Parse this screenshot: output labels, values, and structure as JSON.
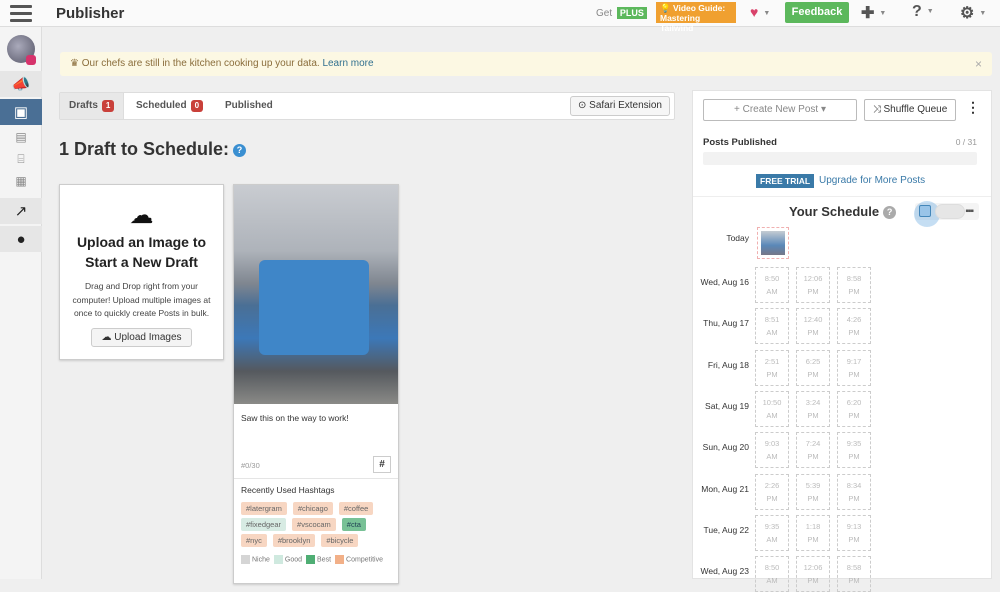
{
  "header": {
    "title": "Publisher",
    "get": "Get",
    "plus": "PLUS",
    "video_guide": "💡 Video Guide: Mastering Tailwind",
    "feedback": "Feedback"
  },
  "alert": {
    "text": "Our chefs are still in the kitchen cooking up your data.",
    "link": "Learn more",
    "close": "×"
  },
  "tabs": [
    {
      "label": "Drafts",
      "count": "1"
    },
    {
      "label": "Scheduled",
      "count": "0"
    },
    {
      "label": "Published"
    }
  ],
  "safari": "Safari Extension",
  "heading": "1 Draft to Schedule:",
  "upload": {
    "title": "Upload an Image to Start a New Draft",
    "desc": "Drag and Drop right from your computer! Upload multiple images at once to quickly create Posts in bulk.",
    "button": "Upload Images"
  },
  "post": {
    "caption": "Saw this on the way to work!",
    "count": "#0/30",
    "hash_button": "#",
    "recent_title": "Recently Used Hashtags",
    "hashtags": [
      {
        "t": "#latergram",
        "k": "comp"
      },
      {
        "t": "#chicago",
        "k": "comp"
      },
      {
        "t": "#coffee",
        "k": "comp"
      },
      {
        "t": "#fixedgear",
        "k": "good"
      },
      {
        "t": "#vscocam",
        "k": "comp"
      },
      {
        "t": "#cta",
        "k": "best"
      },
      {
        "t": "#nyc",
        "k": "comp"
      },
      {
        "t": "#brooklyn",
        "k": "comp"
      },
      {
        "t": "#bicycle",
        "k": "comp"
      }
    ],
    "legend": [
      {
        "label": "Niche",
        "color": "#d5d5d5"
      },
      {
        "label": "Good",
        "color": "#cfe9df"
      },
      {
        "label": "Best",
        "color": "#4fae74"
      },
      {
        "label": "Competitive",
        "color": "#f2b088"
      }
    ]
  },
  "right": {
    "create": "+ Create New Post ▾",
    "shuffle": "⤨ Shuffle Queue",
    "posts_published": "Posts Published",
    "published_count": "0 / 31",
    "published_progress": 0,
    "free_trial": "FREE TRIAL",
    "upgrade": "Upgrade for More Posts",
    "schedule_title": "Your Schedule",
    "today": "Today",
    "days": [
      {
        "d": "Wed, Aug 16",
        "s": [
          [
            "8:50",
            "AM"
          ],
          [
            "12:06",
            "PM"
          ],
          [
            "8:58",
            "PM"
          ]
        ]
      },
      {
        "d": "Thu, Aug 17",
        "s": [
          [
            "8:51",
            "AM"
          ],
          [
            "12:40",
            "PM"
          ],
          [
            "4:26",
            "PM"
          ]
        ]
      },
      {
        "d": "Fri, Aug 18",
        "s": [
          [
            "2:51",
            "PM"
          ],
          [
            "6:25",
            "PM"
          ],
          [
            "9:17",
            "PM"
          ]
        ]
      },
      {
        "d": "Sat, Aug 19",
        "s": [
          [
            "10:50",
            "AM"
          ],
          [
            "3:24",
            "PM"
          ],
          [
            "6:20",
            "PM"
          ]
        ]
      },
      {
        "d": "Sun, Aug 20",
        "s": [
          [
            "9:03",
            "AM"
          ],
          [
            "7:24",
            "PM"
          ],
          [
            "9:35",
            "PM"
          ]
        ]
      },
      {
        "d": "Mon, Aug 21",
        "s": [
          [
            "2:26",
            "PM"
          ],
          [
            "5:39",
            "PM"
          ],
          [
            "8:34",
            "PM"
          ]
        ]
      },
      {
        "d": "Tue, Aug 22",
        "s": [
          [
            "9:35",
            "AM"
          ],
          [
            "1:18",
            "PM"
          ],
          [
            "9:13",
            "PM"
          ]
        ]
      },
      {
        "d": "Wed, Aug 23",
        "s": [
          [
            "8:50",
            "AM"
          ],
          [
            "12:06",
            "PM"
          ],
          [
            "8:58",
            "PM"
          ]
        ]
      }
    ]
  }
}
